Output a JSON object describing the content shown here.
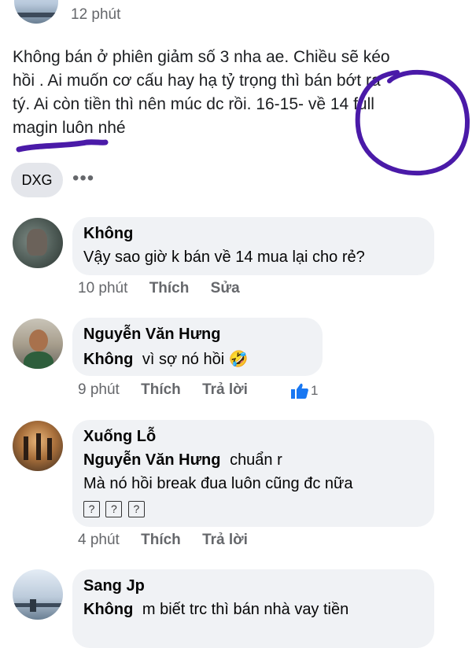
{
  "post": {
    "time": "12 phút",
    "lines": [
      "Không bán ở phiên giảm số 3 nha ae. Chiều sẽ kéo",
      "hồi . Ai muốn cơ cấu hay hạ tỷ trọng thì bán bớt ra",
      "tý. Ai còn tiền thì nên múc dc rồi. 16-15- về 14 full",
      "magin luôn nhé"
    ],
    "tag": "DXG",
    "more": "•••"
  },
  "comments": [
    {
      "name": "Không",
      "text": "Vậy sao giờ k bán về 14 mua lại cho rẻ?",
      "time": "10 phút",
      "like": "Thích",
      "edit": "Sửa"
    },
    {
      "name": "Nguyễn Văn Hưng",
      "mention": "Không",
      "text": "vì sợ nó hồi",
      "emoji": "🤣",
      "time": "9 phút",
      "like": "Thích",
      "reply": "Trả lời",
      "reaction_count": "1"
    },
    {
      "name": "Xuống Lỗ",
      "mention": "Nguyễn Văn Hưng",
      "text_after": "chuẩn r",
      "text2": "Mà nó hồi break đua luôn cũng đc nữa",
      "boxes": [
        "?",
        "?",
        "?"
      ],
      "time": "4 phút",
      "like": "Thích",
      "reply": "Trả lời"
    },
    {
      "name": "Sang Jp",
      "mention": "Không",
      "text": "m biết trc thì bán nhà vay tiền"
    }
  ],
  "colors": {
    "ink": "#4a1aa8",
    "like_blue": "#1877f2",
    "bubble": "#f0f2f5"
  }
}
